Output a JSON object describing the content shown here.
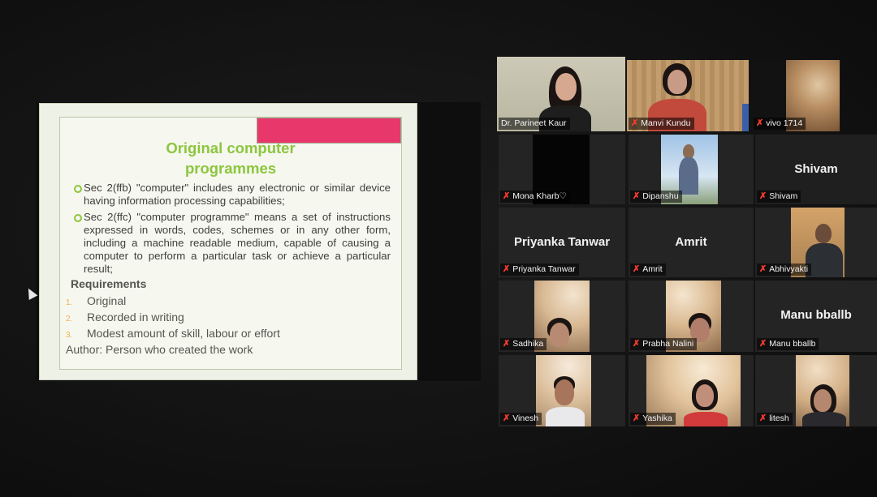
{
  "slide": {
    "title_line1": "Original computer",
    "title_line2": "programmes",
    "bullet1": "Sec 2(ffb) \"computer\" includes any electronic or similar device having information processing capabilities;",
    "bullet2": "Sec 2(ffc) \"computer programme\" means a set of instructions expressed in words, codes, schemes or in any other form, including a machine readable medium, capable of causing a computer to perform a particular task or achieve a particular result;",
    "requirements_heading": "Requirements",
    "requirements": [
      {
        "num": "1.",
        "text": "Original"
      },
      {
        "num": "2.",
        "text": "Recorded in writing"
      },
      {
        "num": "3.",
        "text": "Modest amount of skill, labour or effort"
      }
    ],
    "author": "Author: Person who created the work"
  },
  "participants": [
    {
      "name": "Dr. Parineet Kaur",
      "muted": false
    },
    {
      "name": "Manvi Kundu",
      "muted": true
    },
    {
      "name": "vivo 1714",
      "muted": true
    },
    {
      "name": "Mona Kharb♡",
      "muted": true
    },
    {
      "name": "Dipanshu",
      "muted": true
    },
    {
      "name": "Shivam",
      "muted": true,
      "center": "Shivam"
    },
    {
      "name": "Priyanka Tanwar",
      "muted": true,
      "center": "Priyanka Tanwar"
    },
    {
      "name": "Amrit",
      "muted": true,
      "center": "Amrit"
    },
    {
      "name": "Abhivyakti",
      "muted": true
    },
    {
      "name": "Sadhika",
      "muted": true
    },
    {
      "name": "Prabha Nalini",
      "muted": true
    },
    {
      "name": "Manu   bballb",
      "muted": true,
      "center": "Manu   bballb"
    },
    {
      "name": "Vinesh",
      "muted": true
    },
    {
      "name": "Yashika",
      "muted": true
    },
    {
      "name": "litesh",
      "muted": true
    }
  ],
  "icons": {
    "muted_mic": "✗"
  },
  "colors": {
    "active_speaker": "#e9d84a",
    "title_green": "#8cc63e",
    "muted_red": "#ff3b2f",
    "slide_accent": "#e8386b"
  }
}
